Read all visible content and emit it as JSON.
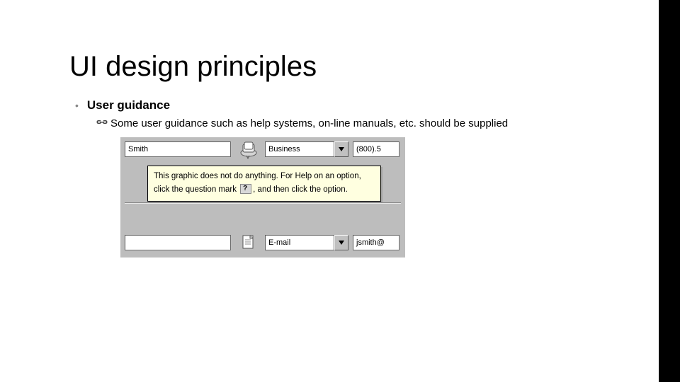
{
  "title": "UI design principles",
  "bullet": {
    "label": "User guidance",
    "sub": "Some user guidance such as help systems, on-line manuals, etc. should be supplied"
  },
  "figure": {
    "top": {
      "name": "Smith",
      "type": "Business",
      "phone": "(800).5"
    },
    "tooltip": {
      "line1": "This graphic does not do anything. For Help on an option, click the question mark ",
      "line2": ", and then click the option."
    },
    "bottom": {
      "type": "E-mail",
      "email": "jsmith@"
    }
  }
}
